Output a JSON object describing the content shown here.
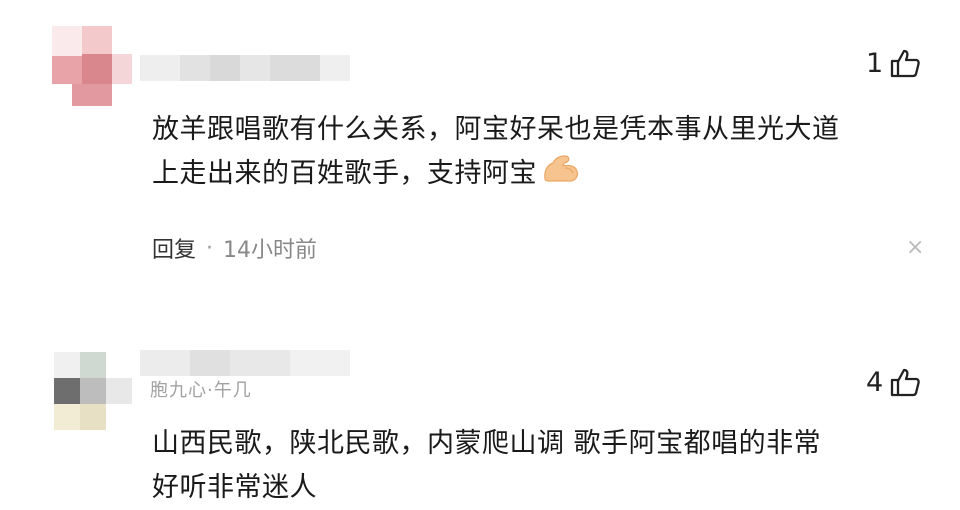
{
  "comments": [
    {
      "text_line1": "放羊跟唱歌有什么关系，阿宝好呆也是凭本事从里光大道",
      "text_line2": "上走出来的百姓歌手，支持阿宝",
      "emoji": "flexed-biceps-icon",
      "likes": "1",
      "reply_label": "回复",
      "separator": "·",
      "time": "14小时前",
      "close_glyph": "×"
    },
    {
      "name_fragment": "胞九心·午几",
      "text_line1": "山西民歌，陕北民歌，内蒙爬山调 歌手阿宝都唱的非常",
      "text_line2": "好听非常迷人",
      "likes": "4"
    }
  ],
  "colors": {
    "avatar1": [
      "#f3c9cc",
      "#e8a3a8",
      "#d98288",
      "#f7dede"
    ],
    "avatar2": [
      "#e6e6e6",
      "#6e6e6e",
      "#cfd9d2",
      "#f2ecd4"
    ]
  }
}
